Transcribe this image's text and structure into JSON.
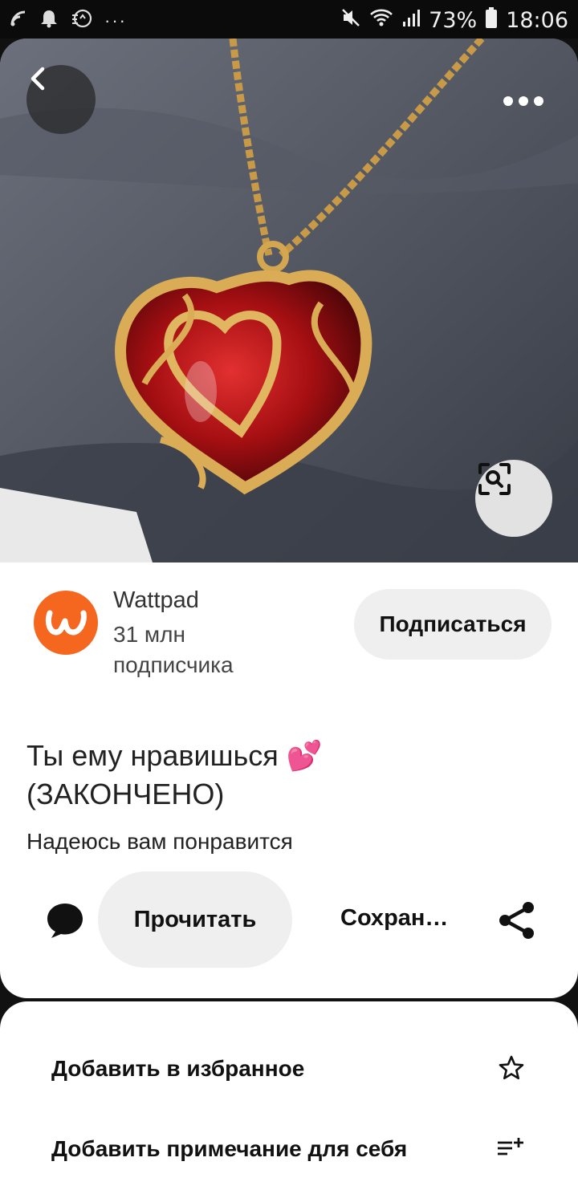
{
  "status_bar": {
    "battery": "73%",
    "time": "18:06",
    "more": "···"
  },
  "pin": {
    "source_name": "Wattpad",
    "subscribers_line1": "31 млн",
    "subscribers_line2": "подписчика",
    "subscribe_label": "Подписаться",
    "title_line1": "Ты ему нравишься 💕",
    "title_line2": "(ЗАКОНЧЕНО)",
    "description": "Надеюсь вам понравится",
    "read_label": "Прочитать",
    "save_label": "Сохран…"
  },
  "sheet": {
    "items": [
      {
        "label": "Добавить в избранное",
        "icon": "star-outline-icon"
      },
      {
        "label": "Добавить примечание для себя",
        "icon": "add-note-icon"
      }
    ]
  },
  "colors": {
    "brand_orange": "#f5661f",
    "pill_bg": "#efefef"
  }
}
